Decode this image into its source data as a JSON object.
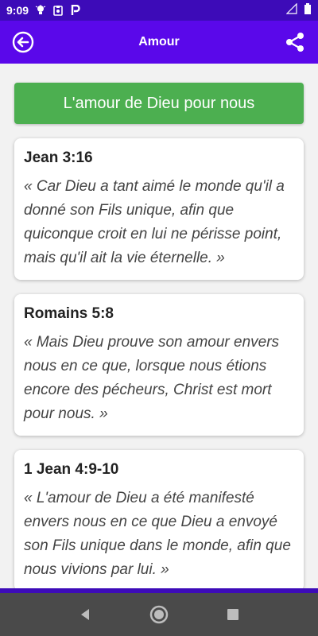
{
  "status_bar": {
    "time": "9:09",
    "left_icons": [
      "lightbulb-icon",
      "clipboard-icon",
      "p-icon"
    ],
    "right_icons": [
      "signal-icon",
      "battery-icon"
    ]
  },
  "app_bar": {
    "title": "Amour",
    "background": "#5a08ea"
  },
  "header_button": {
    "label": "L'amour de Dieu pour nous",
    "color": "#4caf50"
  },
  "verses": [
    {
      "ref": "Jean 3:16",
      "text": "« Car Dieu a tant aimé le monde qu'il a donné son Fils unique, afin que quiconque croit en lui ne périsse point, mais qu'il ait la vie éternelle. »"
    },
    {
      "ref": "Romains 5:8",
      "text": "« Mais Dieu prouve son amour envers nous en ce que, lorsque nous étions encore des pécheurs, Christ est mort pour nous. »"
    },
    {
      "ref": "1 Jean 4:9-10",
      "text": "« L'amour de Dieu a été manifesté envers nous en ce que Dieu a envoyé son Fils unique dans le monde, afin que nous vivions par lui. »"
    }
  ]
}
